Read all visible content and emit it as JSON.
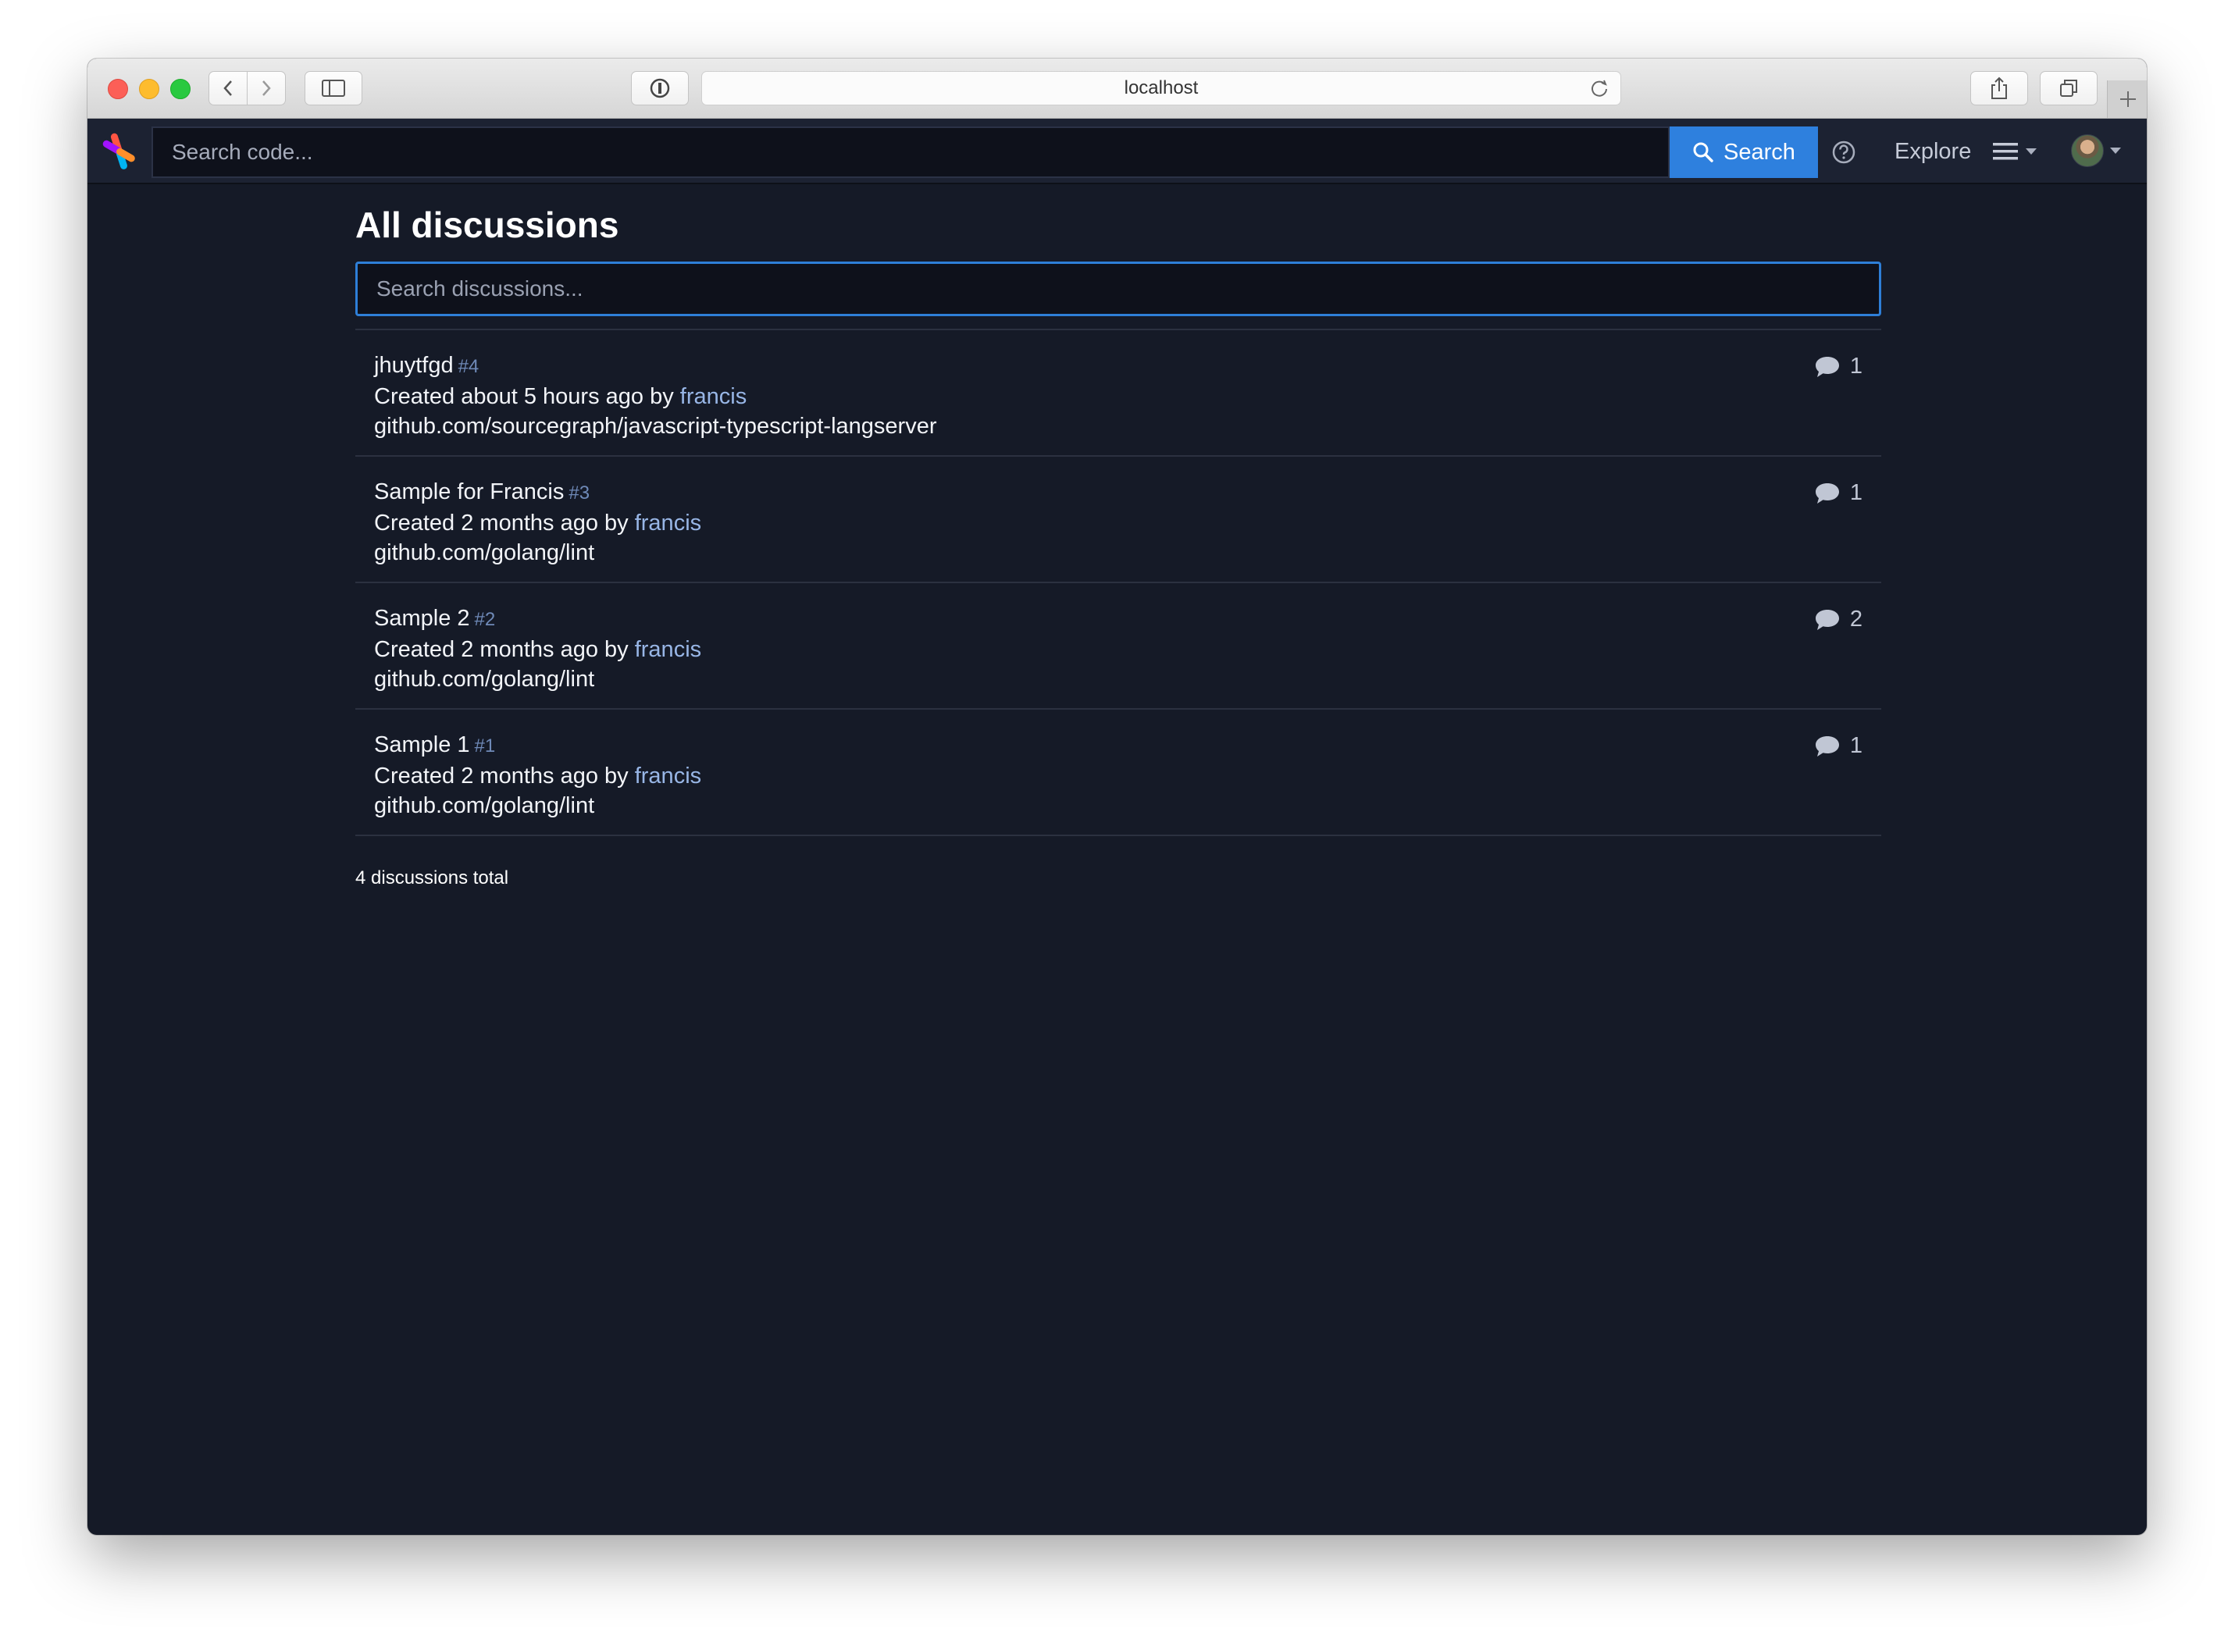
{
  "browser": {
    "url": "localhost"
  },
  "navbar": {
    "search_placeholder": "Search code...",
    "search_button_label": "Search",
    "explore_label": "Explore"
  },
  "page": {
    "title": "All discussions",
    "search_placeholder": "Search discussions...",
    "total_label": "4 discussions total"
  },
  "discussions": [
    {
      "title": "jhuytfgd",
      "id": "#4",
      "created_prefix": "Created about 5 hours ago by",
      "author": "francis",
      "repo": "github.com/sourcegraph/javascript-typescript-langserver",
      "comment_count": "1"
    },
    {
      "title": "Sample for Francis",
      "id": "#3",
      "created_prefix": "Created 2 months ago by",
      "author": "francis",
      "repo": "github.com/golang/lint",
      "comment_count": "1"
    },
    {
      "title": "Sample 2",
      "id": "#2",
      "created_prefix": "Created 2 months ago by",
      "author": "francis",
      "repo": "github.com/golang/lint",
      "comment_count": "2"
    },
    {
      "title": "Sample 1",
      "id": "#1",
      "created_prefix": "Created 2 months ago by",
      "author": "francis",
      "repo": "github.com/golang/lint",
      "comment_count": "1"
    }
  ],
  "colors": {
    "background": "#151a27",
    "accent": "#2e80de",
    "link": "#98b6e6"
  }
}
